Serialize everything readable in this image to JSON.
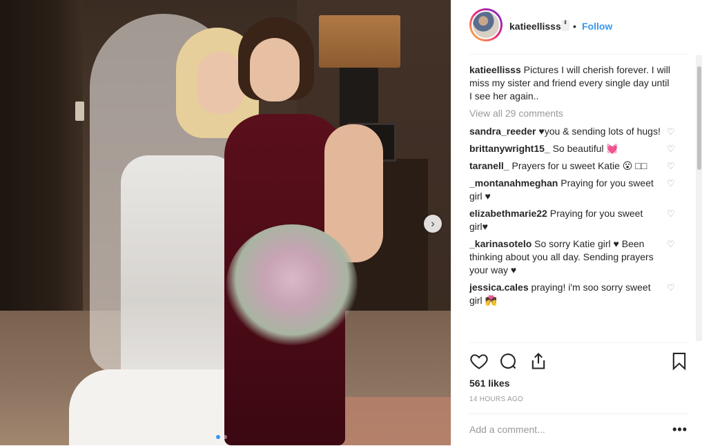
{
  "post": {
    "username": "katieellisss",
    "toggle_glyph": "⬍",
    "separator": "•",
    "follow_label": "Follow",
    "caption_text": "Pictures I will cherish forever. I will miss my sister and friend every single day until I see her again..",
    "view_all": "View all 29 comments",
    "comments": [
      {
        "user": "sandra_reeder",
        "text": "♥you & sending lots of hugs!"
      },
      {
        "user": "brittanywright15_",
        "text": "So beautiful 💓"
      },
      {
        "user": "taranell_",
        "text": "Prayers for u sweet Katie 😮 □□"
      },
      {
        "user": "_montanahmeghan",
        "text": "Praying for you sweet girl ♥"
      },
      {
        "user": "elizabethmarie22",
        "text": "Praying for you sweet girl♥"
      },
      {
        "user": "_karinasotelo",
        "text": "So sorry Katie girl ♥ Been thinking about you all day. Sending prayers your way ♥"
      },
      {
        "user": "jessica.cales",
        "text": "praying! i'm soo sorry sweet girl 💏"
      }
    ],
    "likes": "561 likes",
    "time": "14 HOURS AGO",
    "add_comment_placeholder": "Add a comment...",
    "more_glyph": "•••"
  },
  "icons": {
    "like": "heart-icon",
    "comment": "comment-icon",
    "share": "share-icon",
    "save": "bookmark-icon",
    "next": "chevron-right-icon"
  },
  "glyphs": {
    "next": "›",
    "heart_small": "♡"
  },
  "colors": {
    "accent": "#3897f0",
    "text": "#262626",
    "muted": "#999999",
    "border": "#efefef"
  }
}
